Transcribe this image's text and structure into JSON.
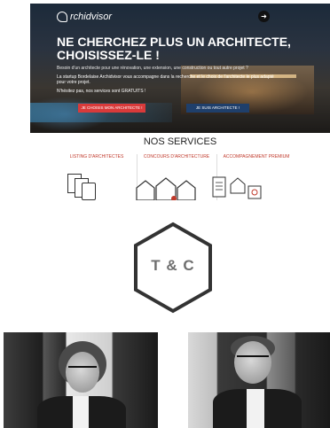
{
  "website": {
    "logo_text": "rchidvisor",
    "headline": "NE CHERCHEZ PLUS UN ARCHITECTE, CHOISISSEZ-LE !",
    "lead": "Besoin d'un architecte pour une rénovation, une extension, une construction ou tout autre projet ?",
    "lead2": "La startup Bordelaise Archidvisor vous accompagne dans la recherche et le choix de l'architecte le plus adapté pour votre projet.",
    "lead3": "N'hésitez pas, nos services sont GRATUITS !",
    "cta_primary": "JE CHOISIS MON ARCHITECTE !",
    "cta_secondary": "JE SUIS ARCHITECTE !",
    "services_title": "NOS SERVICES",
    "services": [
      {
        "label": "LISTING D'ARCHITECTES"
      },
      {
        "label": "CONCOURS D'ARCHITECTURE"
      },
      {
        "label": "ACCOMPAGNEMENT PREMIUM"
      }
    ],
    "menu_icon": "arrow-right-icon",
    "accent_red": "#d93a3a",
    "accent_blue": "#1f3f6b"
  },
  "badge": {
    "text": "T & C",
    "shape": "hexagon"
  },
  "photos": [
    {
      "name": "portrait-left"
    },
    {
      "name": "portrait-right"
    }
  ]
}
